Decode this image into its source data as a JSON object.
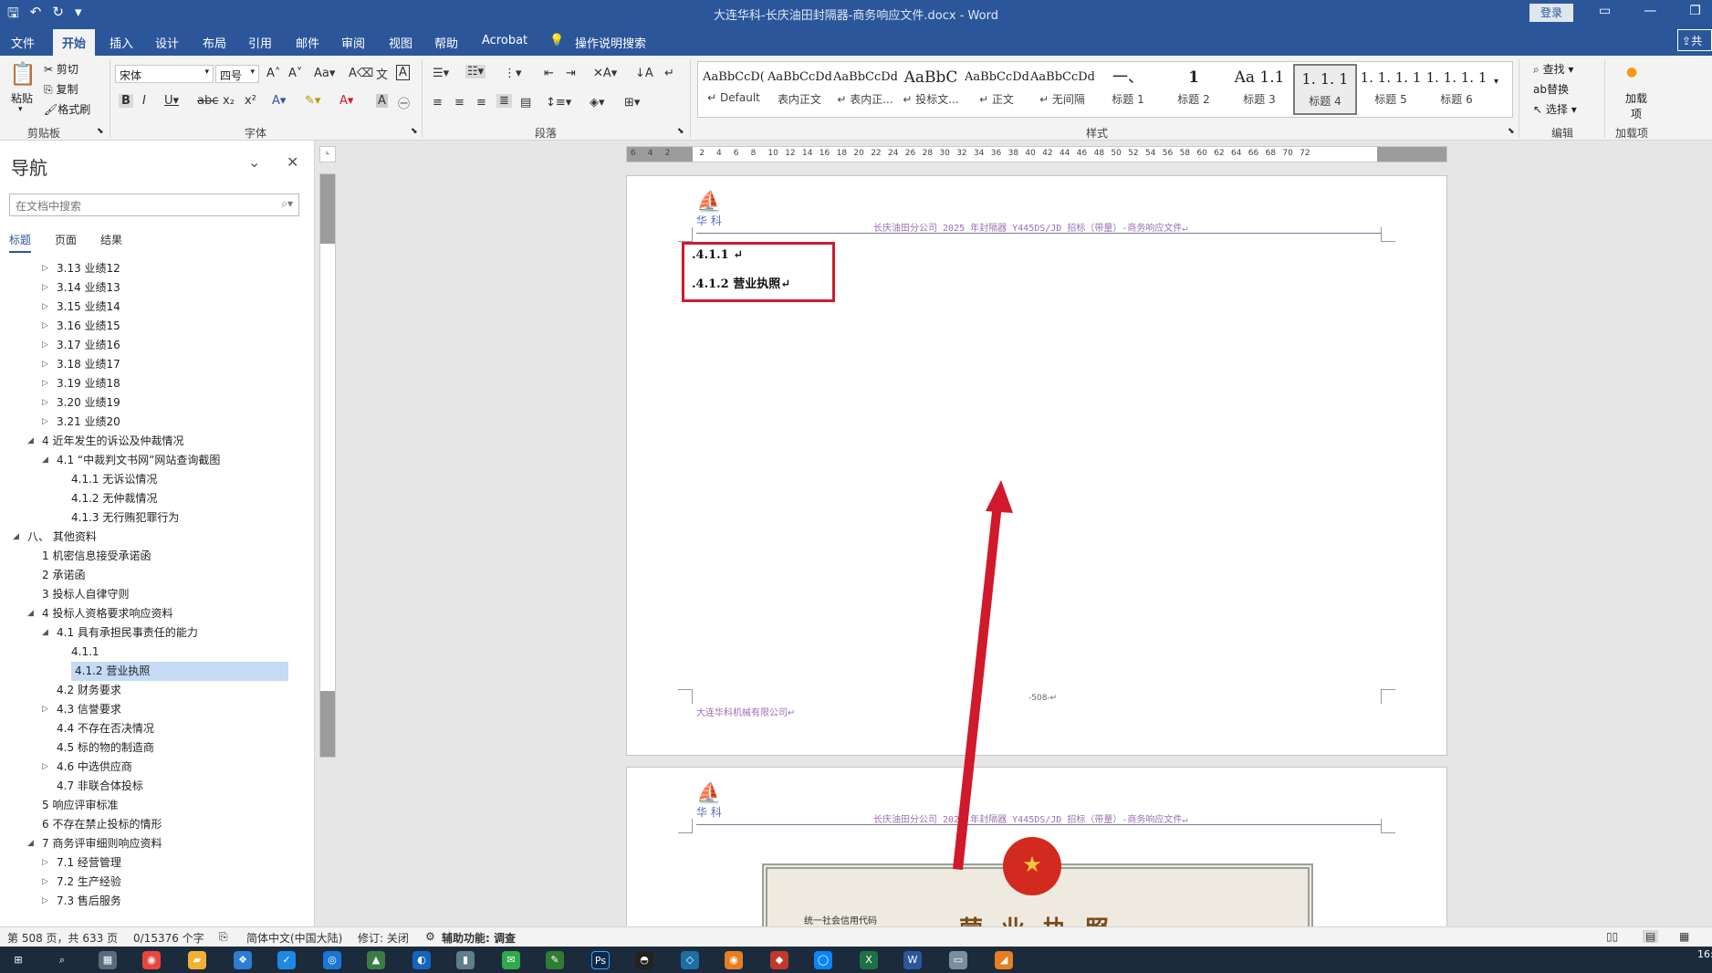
{
  "title_bar": {
    "title": "大连华科-长庆油田封隔器-商务响应文件.docx  -  Word",
    "login": "登录"
  },
  "tabs": [
    {
      "label": "文件"
    },
    {
      "label": "开始"
    },
    {
      "label": "插入"
    },
    {
      "label": "设计"
    },
    {
      "label": "布局"
    },
    {
      "label": "引用"
    },
    {
      "label": "邮件"
    },
    {
      "label": "审阅"
    },
    {
      "label": "视图"
    },
    {
      "label": "帮助"
    },
    {
      "label": "Acrobat"
    },
    {
      "label": "操作说明搜索"
    }
  ],
  "share_label": "共",
  "ribbon": {
    "clipboard": {
      "paste": "粘贴",
      "cut": "剪切",
      "copy": "复制",
      "format_painter": "格式刷",
      "group": "剪贴板"
    },
    "font": {
      "family": "宋体",
      "size": "四号",
      "group": "字体"
    },
    "paragraph": {
      "group": "段落"
    },
    "styles": {
      "group": "样式",
      "items": [
        {
          "sample": "AaBbCcD(",
          "name": "↵ Default"
        },
        {
          "sample": "AaBbCcDdI",
          "name": "表内正文"
        },
        {
          "sample": "AaBbCcDdI",
          "name": "↵ 表内正..."
        },
        {
          "sample": "AaBbC",
          "name": "↵ 投标文..."
        },
        {
          "sample": "AaBbCcDdI",
          "name": "↵ 正文"
        },
        {
          "sample": "AaBbCcDdI",
          "name": "↵ 无间隔"
        },
        {
          "sample": "一、",
          "name": "标题 1"
        },
        {
          "sample": "1",
          "name": "标题 2"
        },
        {
          "sample": "Aa  1.1",
          "name": "标题 3"
        },
        {
          "sample": "1. 1. 1",
          "name": "标题 4"
        },
        {
          "sample": "1. 1. 1. 1",
          "name": "标题 5"
        },
        {
          "sample": "1. 1. 1. 1",
          "name": "标题 6"
        }
      ]
    },
    "editing": {
      "find": "查找",
      "replace": "替换",
      "select": "选择",
      "group": "编辑"
    },
    "addins": {
      "label": "加载项",
      "group": "加载项"
    }
  },
  "nav": {
    "title": "导航",
    "search_placeholder": "在文档中搜索",
    "tabs": [
      "标题",
      "页面",
      "结果"
    ],
    "items": [
      {
        "label": "3.13 业绩12",
        "level": 2,
        "tri": "▷"
      },
      {
        "label": "3.14 业绩13",
        "level": 2,
        "tri": "▷"
      },
      {
        "label": "3.15 业绩14",
        "level": 2,
        "tri": "▷"
      },
      {
        "label": "3.16 业绩15",
        "level": 2,
        "tri": "▷"
      },
      {
        "label": "3.17 业绩16",
        "level": 2,
        "tri": "▷"
      },
      {
        "label": "3.18 业绩17",
        "level": 2,
        "tri": "▷"
      },
      {
        "label": "3.19 业绩18",
        "level": 2,
        "tri": "▷"
      },
      {
        "label": "3.20 业绩19",
        "level": 2,
        "tri": "▷"
      },
      {
        "label": "3.21 业绩20",
        "level": 2,
        "tri": "▷"
      },
      {
        "label": "4 近年发生的诉讼及仲裁情况",
        "level": 1,
        "tri": "◢"
      },
      {
        "label": "4.1 “中裁判文书网”网站查询截图",
        "level": 2,
        "tri": "◢"
      },
      {
        "label": "4.1.1 无诉讼情况",
        "level": 3,
        "tri": ""
      },
      {
        "label": "4.1.2 无仲裁情况",
        "level": 3,
        "tri": ""
      },
      {
        "label": "4.1.3 无行贿犯罪行为",
        "level": 3,
        "tri": ""
      },
      {
        "label": "八、 其他资料",
        "level": 0,
        "tri": "◢"
      },
      {
        "label": "1 机密信息接受承诺函",
        "level": 1,
        "tri": ""
      },
      {
        "label": "2 承诺函",
        "level": 1,
        "tri": ""
      },
      {
        "label": "3 投标人自律守则",
        "level": 1,
        "tri": ""
      },
      {
        "label": "4 投标人资格要求响应资料",
        "level": 1,
        "tri": "◢"
      },
      {
        "label": "4.1 具有承担民事责任的能力",
        "level": 2,
        "tri": "◢"
      },
      {
        "label": "4.1.1",
        "level": 3,
        "tri": ""
      },
      {
        "label": "4.1.2 营业执照",
        "level": 3,
        "tri": "",
        "selected": true
      },
      {
        "label": "4.2 财务要求",
        "level": 2,
        "tri": ""
      },
      {
        "label": "4.3 信誉要求",
        "level": 2,
        "tri": "▷"
      },
      {
        "label": "4.4 不存在否决情况",
        "level": 2,
        "tri": ""
      },
      {
        "label": "4.5 标的物的制造商",
        "level": 2,
        "tri": ""
      },
      {
        "label": "4.6 中选供应商",
        "level": 2,
        "tri": "▷"
      },
      {
        "label": "4.7 非联合体投标",
        "level": 2,
        "tri": ""
      },
      {
        "label": "5 响应评审标准",
        "level": 1,
        "tri": ""
      },
      {
        "label": "6 不存在禁止投标的情形",
        "level": 1,
        "tri": ""
      },
      {
        "label": "7 商务评审细则响应资料",
        "level": 1,
        "tri": "◢"
      },
      {
        "label": "7.1 经营管理",
        "level": 2,
        "tri": "▷"
      },
      {
        "label": "7.2 生产经验",
        "level": 2,
        "tri": "▷"
      },
      {
        "label": "7.3 售后服务",
        "level": 2,
        "tri": "▷"
      }
    ]
  },
  "ruler_numbers": [
    "6",
    "4",
    "2",
    "",
    "2",
    "4",
    "6",
    "8",
    "10",
    "12",
    "14",
    "16",
    "18",
    "20",
    "22",
    "24",
    "26",
    "28",
    "30",
    "32",
    "34",
    "36",
    "38",
    "40",
    "42",
    "44",
    "46",
    "48",
    "50",
    "52",
    "54",
    "56",
    "58",
    "60",
    "62",
    "64",
    "66",
    "68",
    "70",
    "72"
  ],
  "document": {
    "header_text": "长庆油田分公司 2025 年封隔器 Y445DS/JD 招标（带量）-商务响应文件↵",
    "logo_text": "华 科",
    "heading1": ".4.1.1 ↵",
    "heading2": ".4.1.2 营业执照↵",
    "footer_text": "大连华科机械有限公司↵",
    "page_number": "-508-↵",
    "license_code_label": "统一社会信用代码",
    "license_title": "营业执照",
    "emblem_glyph": "★"
  },
  "status_bar": {
    "page": "第 508 页，共 633 页",
    "words": "0/15376 个字",
    "language": "简体中文(中国大陆)",
    "track": "修订: 关闭",
    "accessibility": "辅助功能: 调查"
  },
  "taskbar": {
    "clock": "16:"
  },
  "colors": {
    "brand": "#2b579a",
    "annotation": "#d0192b"
  }
}
